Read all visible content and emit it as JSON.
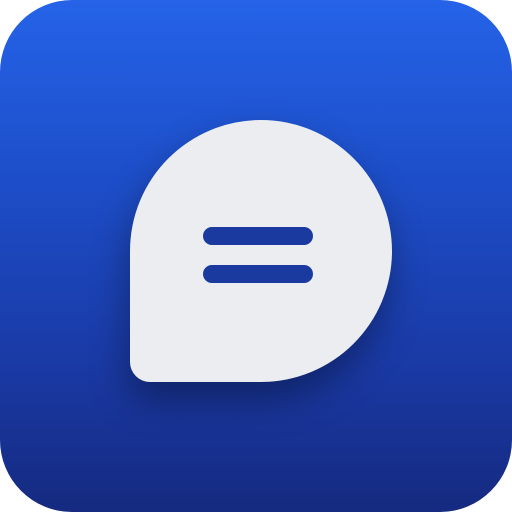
{
  "app_icon": {
    "icon": "chat-bubble-icon",
    "colors": {
      "background_top": "#2563e8",
      "background_bottom": "#152a80",
      "bubble": "#ebedf0",
      "lines": "#1a3a9f"
    }
  }
}
